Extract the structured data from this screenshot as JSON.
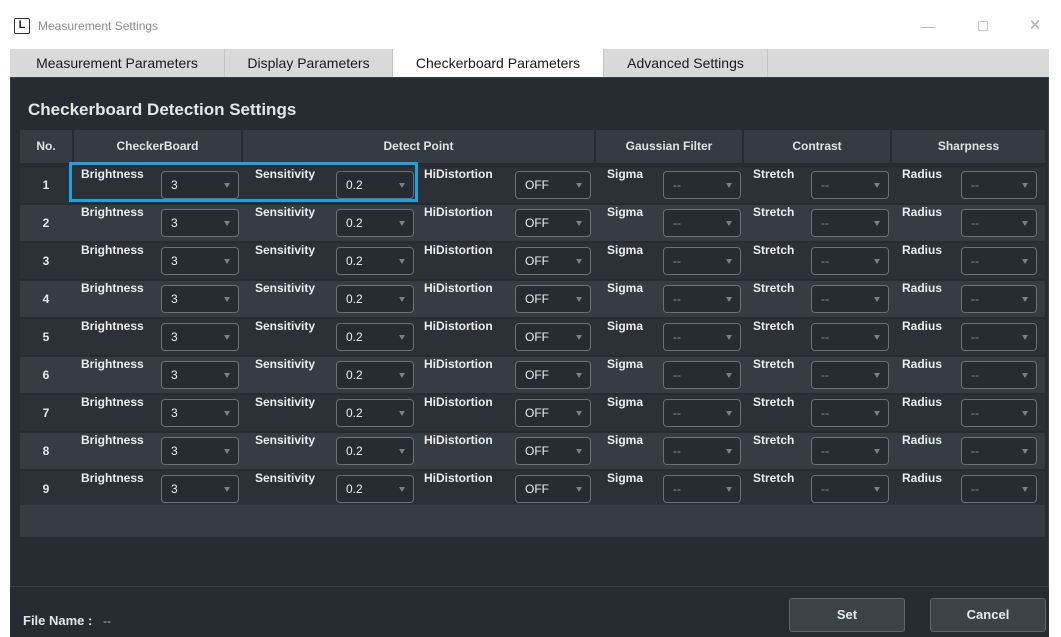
{
  "window": {
    "title": "Measurement Settings",
    "logo_letter": "L",
    "minimize": "—",
    "close": "✕"
  },
  "tabs": [
    {
      "label": "Measurement Parameters",
      "active": false
    },
    {
      "label": "Display Parameters",
      "active": false
    },
    {
      "label": "Checkerboard Parameters",
      "active": true
    },
    {
      "label": "Advanced Settings",
      "active": false
    }
  ],
  "section_title": "Checkerboard Detection Settings",
  "headers": {
    "no": "No.",
    "checkerboard": "CheckerBoard",
    "detect_point": "Detect Point",
    "gaussian": "Gaussian Filter",
    "contrast": "Contrast",
    "sharpness": "Sharpness"
  },
  "labels": {
    "brightness": "Brightness",
    "sensitivity": "Sensitivity",
    "hidistortion": "HiDistortion",
    "sigma": "Sigma",
    "stretch": "Stretch",
    "radius": "Radius"
  },
  "rows": [
    {
      "no": "1",
      "brightness": "3",
      "sensitivity": "0.2",
      "hidistortion": "OFF",
      "sigma": "--",
      "stretch": "--",
      "radius": "--"
    },
    {
      "no": "2",
      "brightness": "3",
      "sensitivity": "0.2",
      "hidistortion": "OFF",
      "sigma": "--",
      "stretch": "--",
      "radius": "--"
    },
    {
      "no": "3",
      "brightness": "3",
      "sensitivity": "0.2",
      "hidistortion": "OFF",
      "sigma": "--",
      "stretch": "--",
      "radius": "--"
    },
    {
      "no": "4",
      "brightness": "3",
      "sensitivity": "0.2",
      "hidistortion": "OFF",
      "sigma": "--",
      "stretch": "--",
      "radius": "--"
    },
    {
      "no": "5",
      "brightness": "3",
      "sensitivity": "0.2",
      "hidistortion": "OFF",
      "sigma": "--",
      "stretch": "--",
      "radius": "--"
    },
    {
      "no": "6",
      "brightness": "3",
      "sensitivity": "0.2",
      "hidistortion": "OFF",
      "sigma": "--",
      "stretch": "--",
      "radius": "--"
    },
    {
      "no": "7",
      "brightness": "3",
      "sensitivity": "0.2",
      "hidistortion": "OFF",
      "sigma": "--",
      "stretch": "--",
      "radius": "--"
    },
    {
      "no": "8",
      "brightness": "3",
      "sensitivity": "0.2",
      "hidistortion": "OFF",
      "sigma": "--",
      "stretch": "--",
      "radius": "--"
    },
    {
      "no": "9",
      "brightness": "3",
      "sensitivity": "0.2",
      "hidistortion": "OFF",
      "sigma": "--",
      "stretch": "--",
      "radius": "--"
    }
  ],
  "footer": {
    "file_label": "File Name :",
    "file_value": "--",
    "set_label": "Set",
    "cancel_label": "Cancel"
  },
  "colors": {
    "panel_bg": "#262c31",
    "highlight": "#1ea3e0"
  }
}
